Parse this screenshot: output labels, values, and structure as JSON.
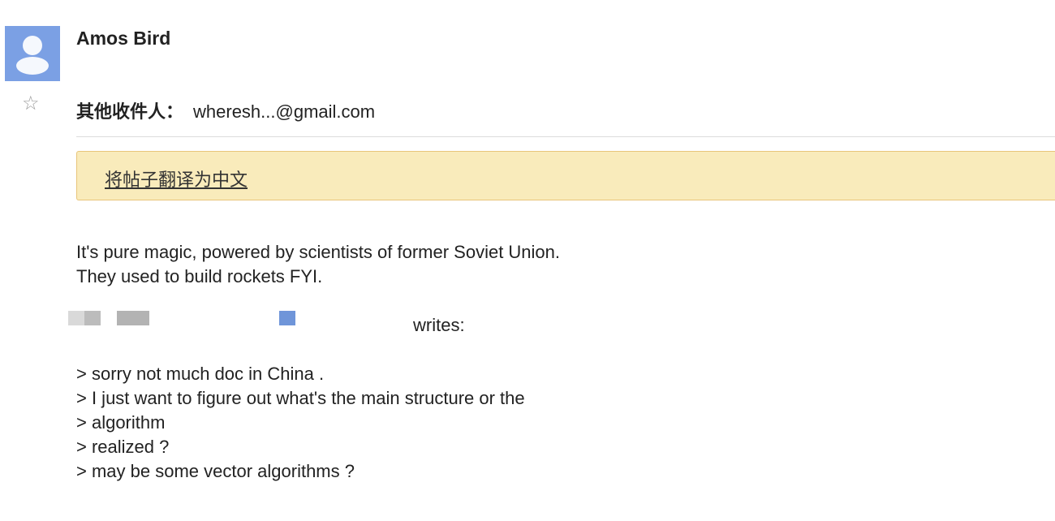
{
  "message": {
    "sender_name": "Amos Bird",
    "recipients_label": "其他收件人：",
    "recipients_value": "wheresh...@gmail.com",
    "translate_link": "将帖子翻译为中文",
    "body_lines": [
      "It's pure magic, powered by scientists of former Soviet Union.",
      "They used to build rockets FYI."
    ],
    "quote_header_suffix": "writes:",
    "quoted_lines": [
      "> sorry not much doc in China .",
      "> I just want to figure out what's the main structure or the",
      "> algorithm",
      "> realized ?",
      "> may be some vector algorithms ?"
    ]
  },
  "icons": {
    "avatar": "person-avatar-icon",
    "star": "star-icon"
  },
  "colors": {
    "avatar_bg": "#7ba0e4",
    "translate_bar_bg": "#f9ebbb",
    "translate_bar_border": "#e8c57a",
    "divider": "#dcdcdc"
  }
}
